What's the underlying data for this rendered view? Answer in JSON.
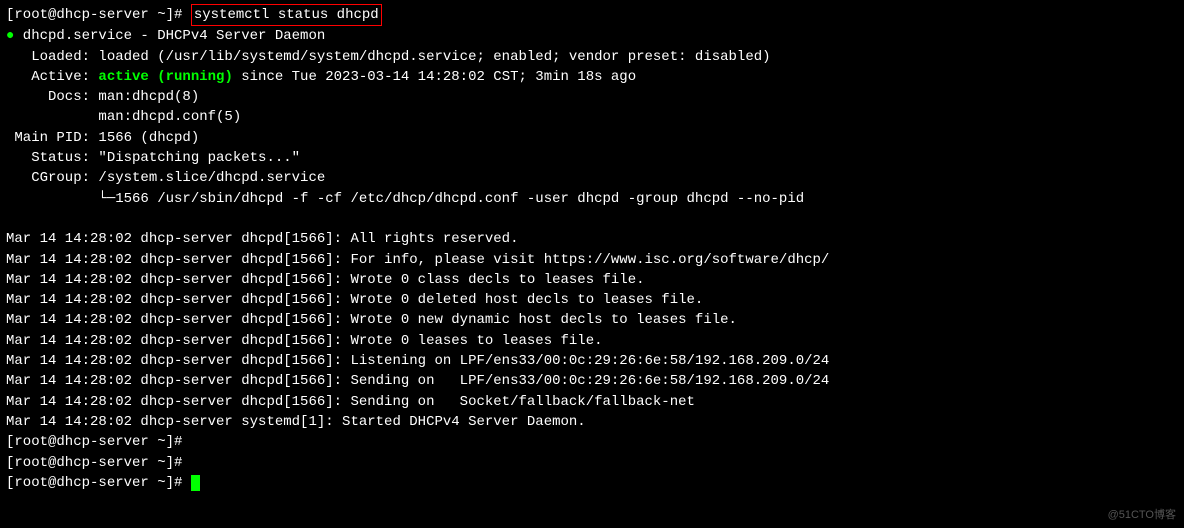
{
  "prompt1": "[root@dhcp-server ~]# ",
  "command": "systemctl status dhcpd",
  "service_line": " dhcpd.service - DHCPv4 Server Daemon",
  "loaded_line": "   Loaded: loaded (/usr/lib/systemd/system/dhcpd.service; enabled; vendor preset: disabled)",
  "active_prefix": "   Active: ",
  "active_status": "active (running)",
  "active_suffix": " since Tue 2023-03-14 14:28:02 CST; 3min 18s ago",
  "docs1": "     Docs: man:dhcpd(8)",
  "docs2": "           man:dhcpd.conf(5)",
  "mainpid": " Main PID: 1566 (dhcpd)",
  "status": "   Status: \"Dispatching packets...\"",
  "cgroup": "   CGroup: /system.slice/dhcpd.service",
  "cgroup_child": "           └─1566 /usr/sbin/dhcpd -f -cf /etc/dhcp/dhcpd.conf -user dhcpd -group dhcpd --no-pid",
  "logs": [
    "Mar 14 14:28:02 dhcp-server dhcpd[1566]: All rights reserved.",
    "Mar 14 14:28:02 dhcp-server dhcpd[1566]: For info, please visit https://www.isc.org/software/dhcp/",
    "Mar 14 14:28:02 dhcp-server dhcpd[1566]: Wrote 0 class decls to leases file.",
    "Mar 14 14:28:02 dhcp-server dhcpd[1566]: Wrote 0 deleted host decls to leases file.",
    "Mar 14 14:28:02 dhcp-server dhcpd[1566]: Wrote 0 new dynamic host decls to leases file.",
    "Mar 14 14:28:02 dhcp-server dhcpd[1566]: Wrote 0 leases to leases file.",
    "Mar 14 14:28:02 dhcp-server dhcpd[1566]: Listening on LPF/ens33/00:0c:29:26:6e:58/192.168.209.0/24",
    "Mar 14 14:28:02 dhcp-server dhcpd[1566]: Sending on   LPF/ens33/00:0c:29:26:6e:58/192.168.209.0/24",
    "Mar 14 14:28:02 dhcp-server dhcpd[1566]: Sending on   Socket/fallback/fallback-net",
    "Mar 14 14:28:02 dhcp-server systemd[1]: Started DHCPv4 Server Daemon."
  ],
  "prompt2": "[root@dhcp-server ~]#",
  "prompt3": "[root@dhcp-server ~]#",
  "prompt4": "[root@dhcp-server ~]# ",
  "watermark": "@51CTO博客"
}
